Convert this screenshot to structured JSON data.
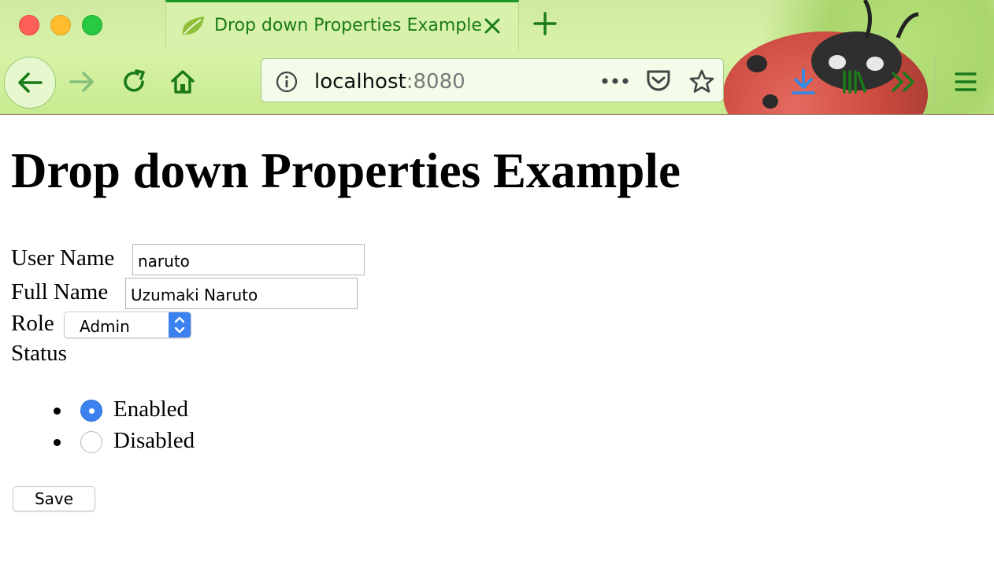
{
  "browser": {
    "tab_title": "Drop down Properties Example",
    "url_host": "localhost",
    "url_port": ":8080",
    "accent_color": "#1b9a2a"
  },
  "page": {
    "heading": "Drop down Properties Example",
    "user_name_label": "User Name",
    "user_name_value": "naruto",
    "full_name_label": "Full Name",
    "full_name_value": "Uzumaki Naruto",
    "role_label": "Role",
    "role_selected": "Admin",
    "status_label": "Status",
    "status_options": [
      {
        "label": "Enabled",
        "checked": true
      },
      {
        "label": "Disabled",
        "checked": false
      }
    ],
    "save_label": "Save"
  },
  "icons": [
    "back-arrow-icon",
    "forward-arrow-icon",
    "reload-icon",
    "home-icon",
    "info-icon",
    "more-icon",
    "pocket-icon",
    "bookmark-star-icon",
    "download-icon",
    "library-icon",
    "overflow-chevrons-icon",
    "hamburger-menu-icon",
    "close-icon",
    "plus-icon",
    "leaf-favicon"
  ]
}
